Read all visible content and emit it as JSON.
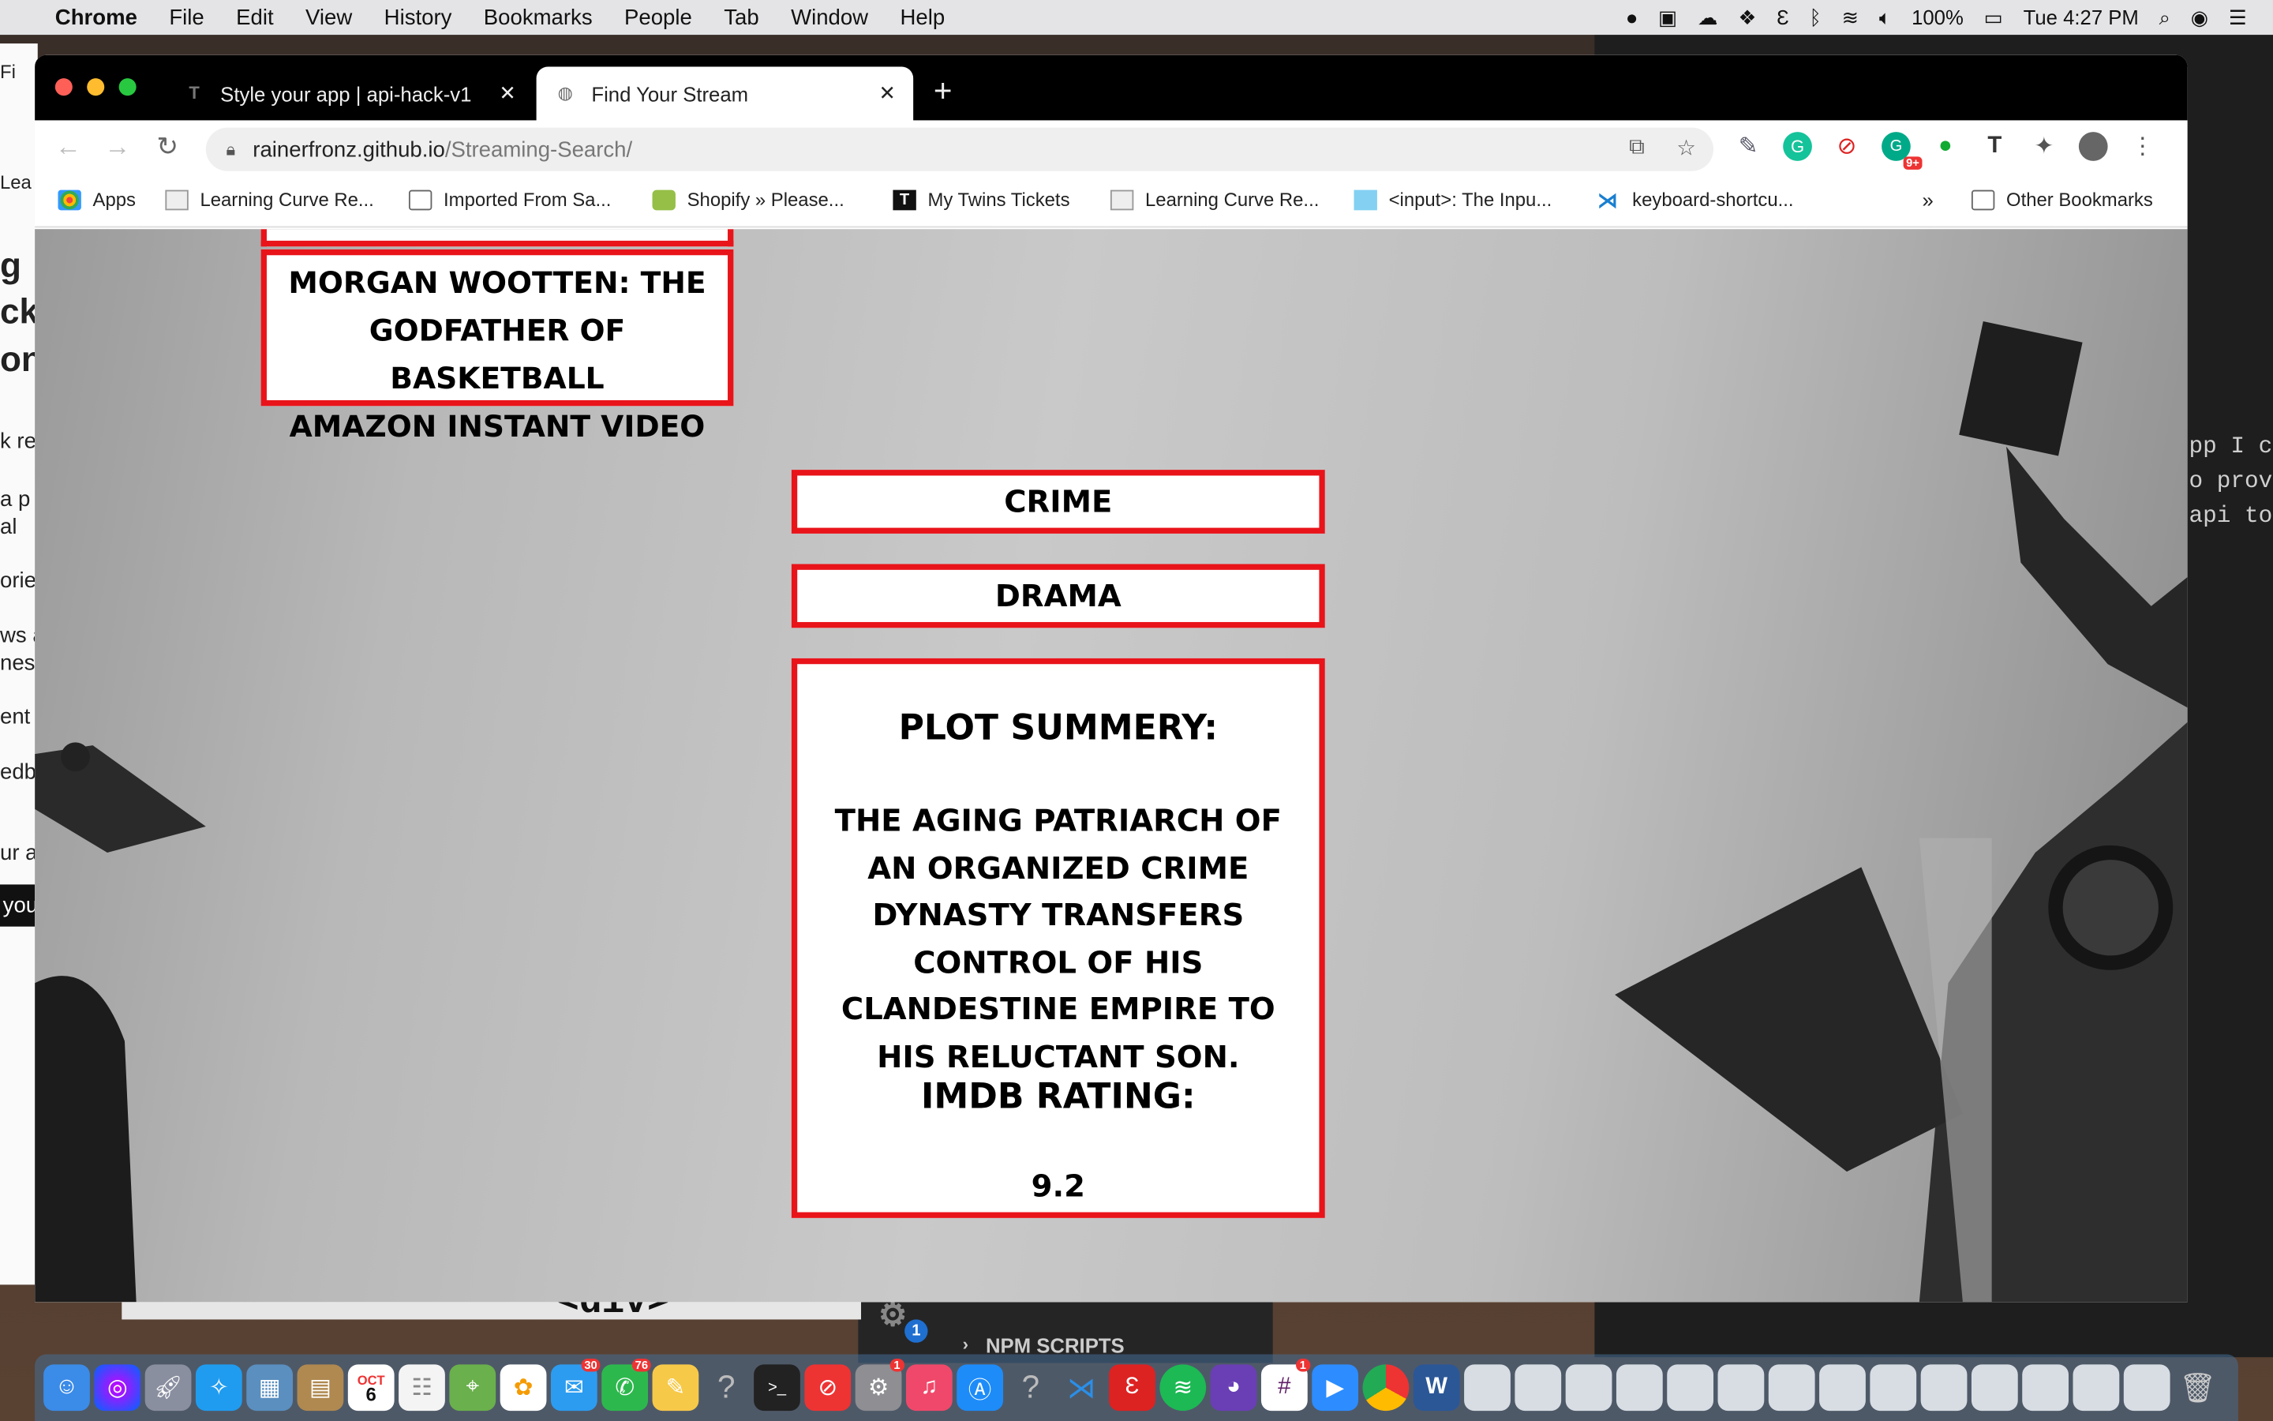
{
  "menubar": {
    "app": "Chrome",
    "items": [
      "File",
      "Edit",
      "View",
      "History",
      "Bookmarks",
      "People",
      "Tab",
      "Window",
      "Help"
    ],
    "battery": "100%",
    "clock": "Tue 4:27 PM"
  },
  "browser": {
    "tabs": [
      {
        "title": "Style your app | api-hack-v1",
        "active": false
      },
      {
        "title": "Find Your Stream",
        "active": true
      }
    ],
    "url_host": "rainerfronz.github.io",
    "url_path": "/Streaming-Search/",
    "extension_badge": "9+",
    "bookmarks": [
      "Apps",
      "Learning Curve Re...",
      "Imported From Sa...",
      "Shopify » Please...",
      "My Twins Tickets",
      "Learning Curve Re...",
      "<input>: The Inpu...",
      "keyboard-shortcu..."
    ],
    "more_bookmarks": "»",
    "other_bookmarks": "Other Bookmarks"
  },
  "page": {
    "show_title": "MORGAN WOOTTEN: THE GODFATHER OF BASKETBALL",
    "service": "AMAZON INSTANT VIDEO",
    "genres": [
      "CRIME",
      "DRAMA"
    ],
    "plot_heading": "PLOT SUMMERY:",
    "plot_text": "THE AGING PATRIARCH OF AN ORGANIZED CRIME DYNASTY TRANSFERS CONTROL OF HIS CLANDESTINE EMPIRE TO HIS RELUCTANT SON.",
    "rating_heading": "IMDB RATING:",
    "rating_value": "9.2"
  },
  "background": {
    "left_window_fragments": [
      "Fi",
      "Lea",
      "g",
      "ck",
      "one",
      "k re",
      "a p",
      "al",
      "orie",
      "ws a",
      "nes",
      "ent",
      "edb",
      "ur a",
      "you"
    ],
    "editor_code": "pp I c\no prov\napi to",
    "npm_scripts": "NPM SCRIPTS",
    "gear_badge": "1",
    "template_text": "<div>"
  },
  "dock": {
    "calendar_month": "OCT",
    "calendar_day": "6",
    "badges": {
      "messages": "30",
      "facetime": "76",
      "preferences": "1",
      "slack": "1"
    }
  },
  "colors": {
    "accent": "#e8141a",
    "tabbar": "#000000"
  }
}
